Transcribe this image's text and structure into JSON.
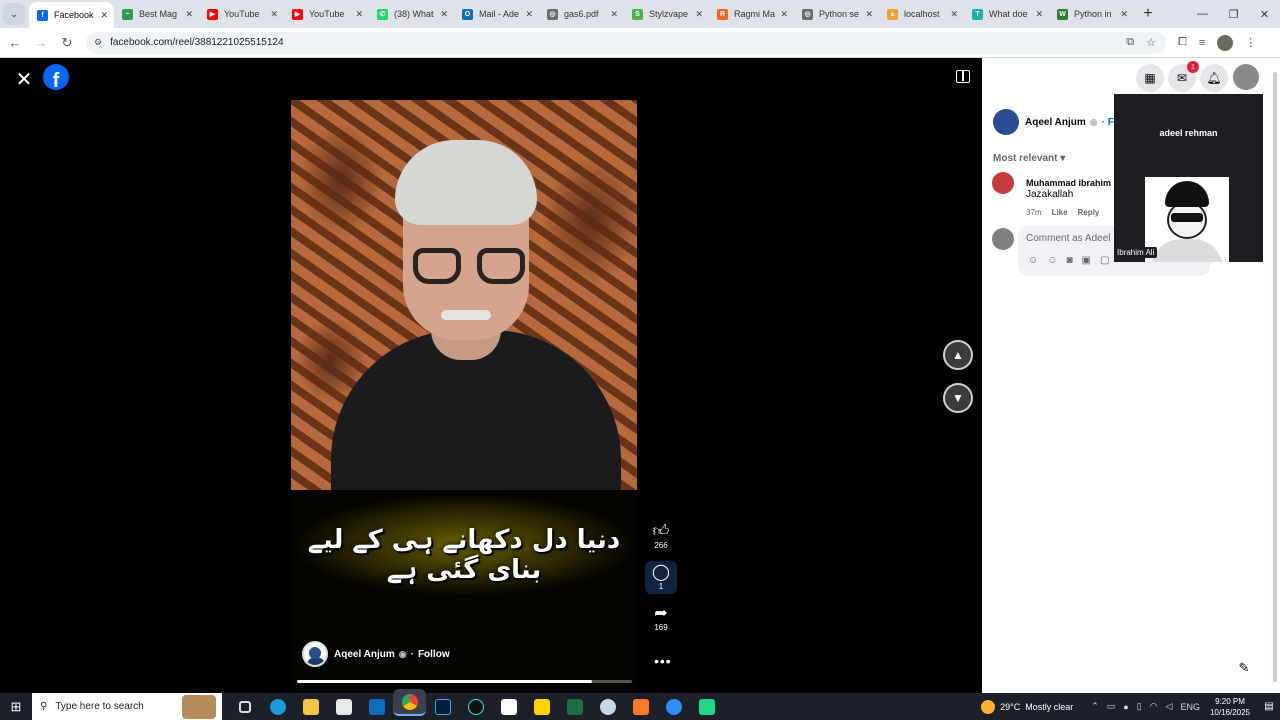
{
  "browser": {
    "tabs": [
      {
        "title": "Facebook",
        "color": "#0866ff",
        "glyph": "f",
        "active": true
      },
      {
        "title": "Best Mag",
        "color": "#2e9b4e",
        "glyph": "~"
      },
      {
        "title": "YouTube",
        "color": "#ff0000",
        "glyph": "▶"
      },
      {
        "title": "YouTube",
        "color": "#ff0000",
        "glyph": "▶"
      },
      {
        "title": "(38) What",
        "color": "#25d366",
        "glyph": "✆"
      },
      {
        "title": "Mail - Ade",
        "color": "#0f6cbd",
        "glyph": "O"
      },
      {
        "title": "gas6.pdf",
        "color": "#6b6b6b",
        "glyph": "◎"
      },
      {
        "title": "Stylzvape",
        "color": "#4caf50",
        "glyph": "S"
      },
      {
        "title": "Ragmi Ma",
        "color": "#f26522",
        "glyph": "R"
      },
      {
        "title": "Python se",
        "color": "#6b6b6b",
        "glyph": "◎"
      },
      {
        "title": "localhost",
        "color": "#f0a030",
        "glyph": "▲"
      },
      {
        "title": "What doe",
        "color": "#20b2aa",
        "glyph": "T"
      },
      {
        "title": "Python in",
        "color": "#2e7d32",
        "glyph": "W"
      }
    ],
    "new_tab": "+",
    "win": {
      "minimize": "—",
      "restore": "❐",
      "close": "✕"
    },
    "url": "facebook.com/reel/3881221025515124"
  },
  "reel": {
    "caption": "دنیا دل دکھانے ہی کے لیے بنای گئی ہے",
    "creator_name": "Aqeel Anjum",
    "follow_label": "Follow",
    "likes": "266",
    "comments": "1",
    "shares": "169",
    "progress": 0.88
  },
  "panel": {
    "notification_count": "1",
    "owner_name": "Aqeel Anjum",
    "owner_follow": "· Follo",
    "sort_label": "Most relevant",
    "comment": {
      "author": "Muhammad ibrahim",
      "text": "Jazakallah",
      "time": "37m",
      "like": "Like",
      "reply": "Reply"
    },
    "composer_placeholder": "Comment as Adeel",
    "hovercard_name": "adeel rehman",
    "hovercard_tag": "Ibrahim Ali"
  },
  "taskbar": {
    "search_placeholder": "Type here to search",
    "temperature": "29°C",
    "weather": "Mostly clear",
    "language": "ENG",
    "time": "9:20 PM",
    "date": "10/16/2025"
  }
}
